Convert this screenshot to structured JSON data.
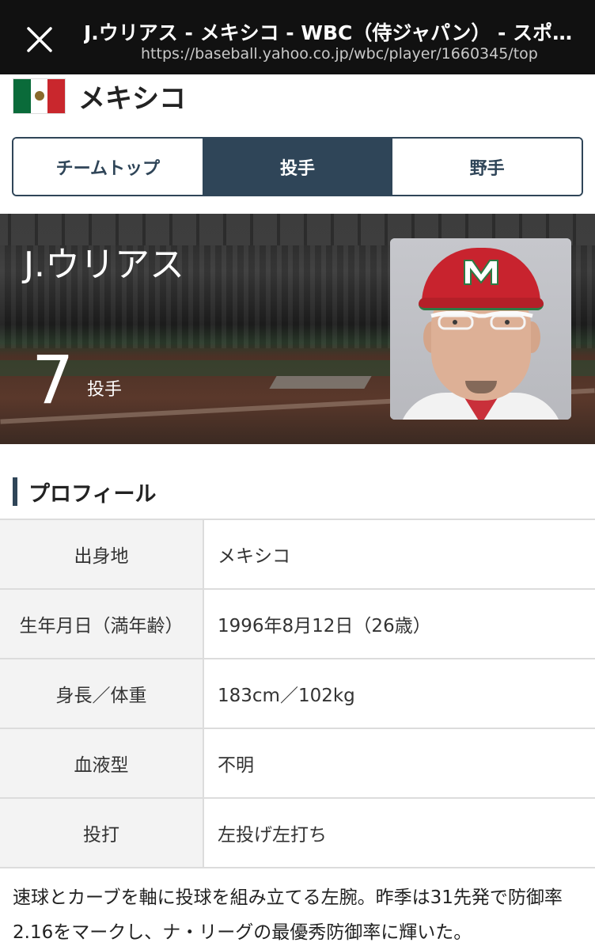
{
  "browser": {
    "title": "J.ウリアス - メキシコ - WBC（侍ジャパン） - スポ…",
    "url": "https://baseball.yahoo.co.jp/wbc/player/1660345/top"
  },
  "country": {
    "name": "メキシコ"
  },
  "tabs": [
    {
      "label": "チームトップ",
      "active": false
    },
    {
      "label": "投手",
      "active": true
    },
    {
      "label": "野手",
      "active": false
    }
  ],
  "player": {
    "name": "J.ウリアス",
    "number": "7",
    "position": "投手"
  },
  "profile": {
    "title": "プロフィール",
    "rows": [
      {
        "label": "出身地",
        "value": "メキシコ"
      },
      {
        "label": "生年月日（満年齢）",
        "value": "1996年8月12日（26歳）"
      },
      {
        "label": "身長／体重",
        "value": "183cm／102kg"
      },
      {
        "label": "血液型",
        "value": "不明"
      },
      {
        "label": "投打",
        "value": "左投げ左打ち"
      }
    ],
    "description": "速球とカーブを軸に投球を組み立てる左腕。昨季は31先発で防御率2.16をマークし、ナ・リーグの最優秀防御率に輝いた。"
  },
  "colors": {
    "navy": "#2f4558",
    "topbar": "#111111",
    "table_key_bg": "#f3f3f3",
    "cap_red": "#c8232e"
  }
}
